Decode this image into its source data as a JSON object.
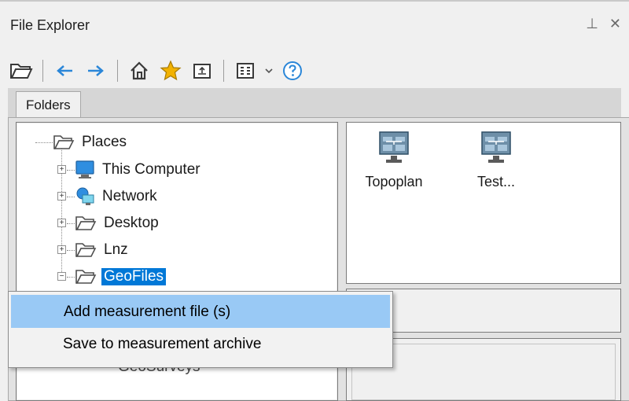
{
  "window": {
    "title": "File Explorer",
    "pin_glyph": "⊥",
    "close_glyph": "✕"
  },
  "toolbar": {
    "items": [
      "open-folder-icon",
      "back-arrow-icon",
      "forward-arrow-icon",
      "home-icon",
      "favorites-star-icon",
      "upload-icon",
      "view-grid-icon",
      "dropdown-icon",
      "help-icon"
    ]
  },
  "tabs": [
    {
      "label": "Folders"
    }
  ],
  "tree": {
    "root": "Places",
    "items": [
      {
        "label": "This Computer",
        "icon": "computer-icon"
      },
      {
        "label": "Network",
        "icon": "network-icon"
      },
      {
        "label": "Desktop",
        "icon": "folder-icon"
      },
      {
        "label": "Lnz",
        "icon": "folder-icon"
      },
      {
        "label": "GeoFiles",
        "icon": "folder-icon",
        "selected": true
      }
    ],
    "hidden_partial": "GeoSurveys"
  },
  "files": [
    {
      "label": "Topoplan"
    },
    {
      "label": "Test..."
    }
  ],
  "context_menu": {
    "items": [
      {
        "label": "Add measurement file (s)",
        "highlighted": true
      },
      {
        "label": "Save to measurement archive",
        "highlighted": false
      }
    ]
  },
  "colors": {
    "selection": "#0078d7",
    "menu_highlight": "#99c9f5",
    "arrow_blue": "#2a86d8",
    "star": "#f2b200"
  }
}
